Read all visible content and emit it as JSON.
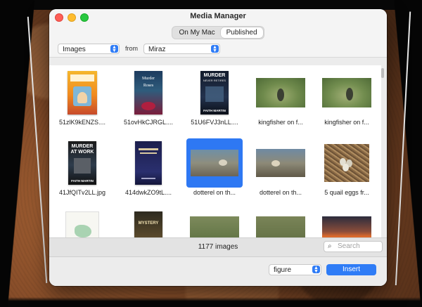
{
  "window": {
    "title": "Media Manager"
  },
  "tabs": [
    {
      "label": "On My Mac",
      "active": false
    },
    {
      "label": "Published",
      "active": true
    }
  ],
  "filter": {
    "media_type": "Images",
    "from_label": "from",
    "source": "Miraz"
  },
  "grid": {
    "items": [
      {
        "caption": "51zlK9kENZS....",
        "thumb": "book-orange"
      },
      {
        "caption": "51ovHkCJRGL....",
        "thumb": "book-roses"
      },
      {
        "caption": "51U6FVJ3nLL....",
        "thumb": "book-murder-retires"
      },
      {
        "caption": "kingfisher on f...",
        "thumb": "photo-kingfisher-1"
      },
      {
        "caption": "kingfisher on f...",
        "thumb": "photo-kingfisher-2"
      },
      {
        "caption": "41JfQITv2LL.jpg",
        "thumb": "book-murder-at-work"
      },
      {
        "caption": "414dwkZO9tL....",
        "thumb": "book-navy"
      },
      {
        "caption": "dotterel on th...",
        "thumb": "photo-dotterel-1",
        "selected": true
      },
      {
        "caption": "dotterel on th...",
        "thumb": "photo-dotterel-2"
      },
      {
        "caption": "5 quail eggs fr...",
        "thumb": "photo-quail-eggs"
      },
      {
        "caption": "",
        "thumb": "map-illustration"
      },
      {
        "caption": "",
        "thumb": "book-country-inn"
      },
      {
        "caption": "",
        "thumb": "photo-birds"
      },
      {
        "caption": "",
        "thumb": "photo-bird-field"
      },
      {
        "caption": "",
        "thumb": "photo-sunset"
      }
    ],
    "book_text": {
      "roses": "Murder\nRoses",
      "retires_title": "MURDER",
      "retires_sub": "NEVER RETIRES",
      "retires_author": "FAITH MARTIN",
      "atwork_title": "MURDER\nAT WORK",
      "atwork_author": "FAITH MARTIN",
      "country_title": "MYSTERY"
    }
  },
  "status": {
    "count": "1177 images",
    "search_placeholder": "Search"
  },
  "footer": {
    "format": "figure",
    "insert_label": "Insert"
  },
  "colors": {
    "accent": "#2f7cf6",
    "selection": "#2e78f3"
  }
}
